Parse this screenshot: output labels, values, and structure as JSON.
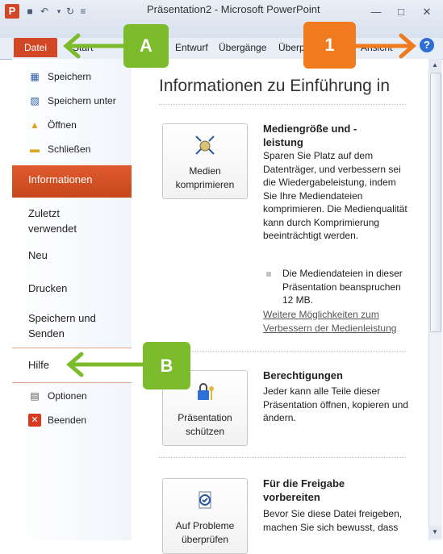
{
  "window": {
    "title": "Präsentation2 - Microsoft PowerPoint",
    "app_logo": "P"
  },
  "ribbon": {
    "file_tab": "Datei",
    "tabs": [
      "Start",
      "Entwurf",
      "Übergänge",
      "Überp",
      "Ansicht"
    ]
  },
  "nav": {
    "small_items": [
      {
        "label": "Speichern",
        "icon": "save-icon"
      },
      {
        "label": "Speichern unter",
        "icon": "save-as-icon"
      },
      {
        "label": "Öffnen",
        "icon": "open-folder-icon"
      },
      {
        "label": "Schließen",
        "icon": "close-folder-icon"
      }
    ],
    "active": "Informationen",
    "big_items": [
      "Zuletzt verwendet",
      "Neu",
      "Drucken",
      "Speichern und Senden",
      "Hilfe"
    ],
    "bottom_items": [
      {
        "label": "Optionen",
        "icon": "options-icon"
      },
      {
        "label": "Beenden",
        "icon": "exit-icon"
      }
    ]
  },
  "main": {
    "title": "Informationen zu Einführung in",
    "sections": [
      {
        "button": "Medien komprimieren",
        "title": "Mediengröße und -leistung",
        "text": "Sparen Sie Platz auf dem Datenträger, und verbessern sei die Wiedergabeleistung, indem Sie Ihre Mediendateien komprimieren. Die Medienqualität kann durch Komprimierung beeinträchtigt werden.",
        "bullet": "Die Mediendateien in dieser Präsentation beanspruchen 12 MB.",
        "link": "Weitere Möglichkeiten zum Verbessern der Medienleistung"
      },
      {
        "button": "Präsentation schützen",
        "title": "Berechtigungen",
        "text": "Jeder kann alle Teile dieser Präsentation öffnen, kopieren und ändern."
      },
      {
        "button": "Auf Probleme überprüfen",
        "title": "Für die Freigabe vorbereiten",
        "text": "Bevor Sie diese Datei freigeben, machen Sie sich bewusst, dass"
      }
    ]
  },
  "annotations": {
    "a": "A",
    "one": "1",
    "b": "B"
  },
  "colors": {
    "accent": "#d24726",
    "callout_green": "#7cbb2c",
    "callout_orange": "#f07a1e"
  }
}
